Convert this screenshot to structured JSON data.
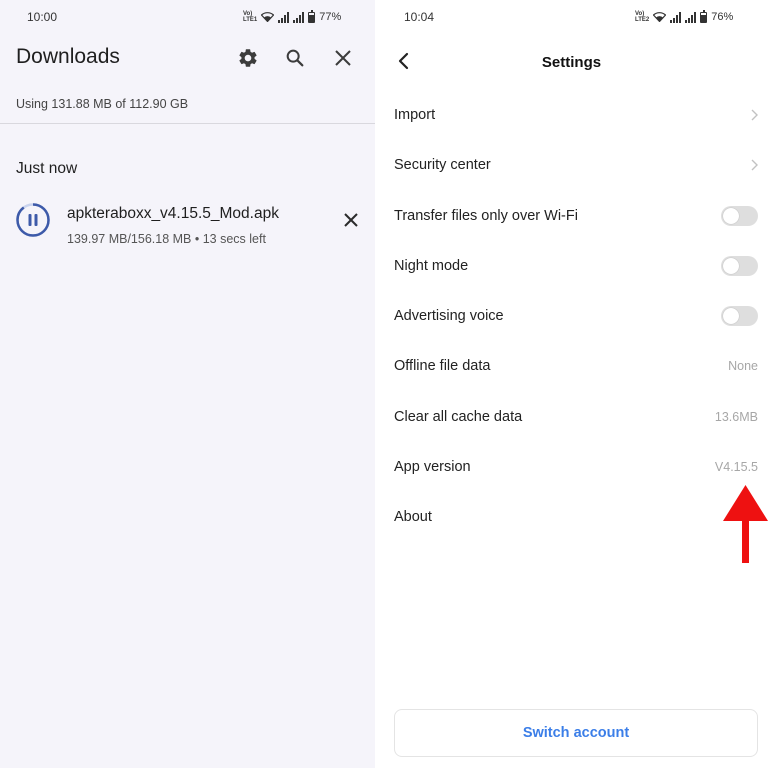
{
  "left_screen": {
    "status_bar": {
      "time": "10:00",
      "network": "Vo) LTE1",
      "battery": "77%"
    },
    "title": "Downloads",
    "icons": {
      "settings": "gear-icon",
      "search": "search-icon",
      "close": "close-icon"
    },
    "storage_usage": "Using 131.88 MB of 112.90 GB",
    "section_label": "Just now",
    "download": {
      "status_icon": "pause-icon",
      "progress": 0.897,
      "filename": "apkteraboxx_v4.15.5_Mod.apk",
      "details": "139.97 MB/156.18 MB • 13 secs left"
    }
  },
  "right_screen": {
    "status_bar": {
      "time": "10:04",
      "network": "Vo) LTE2",
      "battery": "76%"
    },
    "title": "Settings",
    "rows": [
      {
        "label": "Import",
        "control": "chevron"
      },
      {
        "label": "Security center",
        "control": "chevron"
      },
      {
        "label": "Transfer files only over Wi-Fi",
        "control": "toggle",
        "on": false
      },
      {
        "label": "Night mode",
        "control": "toggle",
        "on": false
      },
      {
        "label": "Advertising voice",
        "control": "toggle",
        "on": false
      },
      {
        "label": "Offline file data",
        "value": "None"
      },
      {
        "label": "Clear all cache data",
        "value": "13.6MB"
      },
      {
        "label": "App version",
        "value": "V4.15.5"
      },
      {
        "label": "About"
      }
    ],
    "annotation": {
      "icon": "red-up-arrow-icon",
      "color": "#ee1111"
    },
    "switch_account_label": "Switch account",
    "accent_color": "#3b7ee8"
  }
}
